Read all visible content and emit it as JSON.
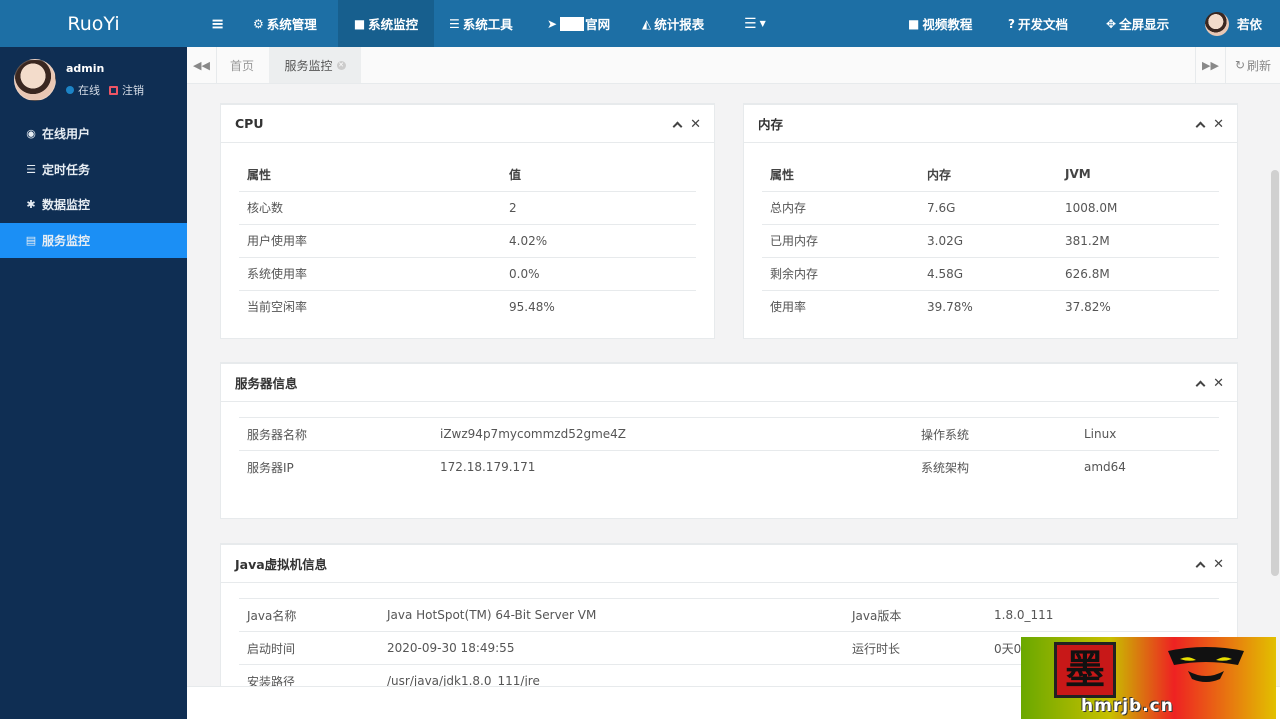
{
  "app": {
    "logo": "RuoYi"
  },
  "user": {
    "name": "admin",
    "status": "在线",
    "logout": "注销",
    "nav_name": "若依"
  },
  "sidebar": {
    "items": [
      {
        "label": "在线用户",
        "icon": "user-circle-icon"
      },
      {
        "label": "定时任务",
        "icon": "tasks-icon"
      },
      {
        "label": "数据监控",
        "icon": "bug-icon"
      },
      {
        "label": "服务监控",
        "icon": "server-icon",
        "active": true
      }
    ]
  },
  "topnav": {
    "menu_toggle": "≡",
    "items": [
      {
        "label": "系统管理",
        "icon": "gear-icon"
      },
      {
        "label": "系统监控",
        "icon": "video-icon",
        "active": true
      },
      {
        "label": "系统工具",
        "icon": "bars-icon"
      },
      {
        "label": "官网",
        "icon": "location-arrow-icon"
      },
      {
        "label": "统计报表",
        "icon": "area-chart-icon"
      },
      {
        "label": "",
        "icon": "list-icon"
      }
    ],
    "right": [
      {
        "label": "视频教程",
        "icon": "video-icon"
      },
      {
        "label": "开发文档",
        "icon": "question-circle-icon"
      },
      {
        "label": "全屏显示",
        "icon": "arrows-alt-icon"
      }
    ]
  },
  "tabs": {
    "items": [
      {
        "label": "首页"
      },
      {
        "label": "服务监控",
        "active": true
      }
    ],
    "refresh": "刷新"
  },
  "cpu": {
    "title": "CPU",
    "headers": [
      "属性",
      "值"
    ],
    "rows": [
      [
        "核心数",
        "2"
      ],
      [
        "用户使用率",
        "4.02%"
      ],
      [
        "系统使用率",
        "0.0%"
      ],
      [
        "当前空闲率",
        "95.48%"
      ]
    ]
  },
  "memory": {
    "title": "内存",
    "headers": [
      "属性",
      "内存",
      "JVM"
    ],
    "rows": [
      [
        "总内存",
        "7.6G",
        "1008.0M"
      ],
      [
        "已用内存",
        "3.02G",
        "381.2M"
      ],
      [
        "剩余内存",
        "4.58G",
        "626.8M"
      ],
      [
        "使用率",
        "39.78%",
        "37.82%"
      ]
    ]
  },
  "server": {
    "title": "服务器信息",
    "rows": [
      [
        "服务器名称",
        "iZwz94p7mycommzd52gme4Z",
        "操作系统",
        "Linux"
      ],
      [
        "服务器IP",
        "172.18.179.171",
        "系统架构",
        "amd64"
      ]
    ]
  },
  "jvm": {
    "title": "Java虚拟机信息",
    "rows": [
      [
        "Java名称",
        "Java HotSpot(TM) 64-Bit Server VM",
        "Java版本",
        "1.8.0_111"
      ],
      [
        "启动时间",
        "2020-09-30 18:49:55",
        "运行时长",
        "0天0"
      ],
      [
        "安装路径",
        "/usr/java/jdk1.8.0_111/jre",
        "",
        ""
      ]
    ]
  },
  "watermark": {
    "text": "hmrjb.cn",
    "seal": "墨"
  }
}
